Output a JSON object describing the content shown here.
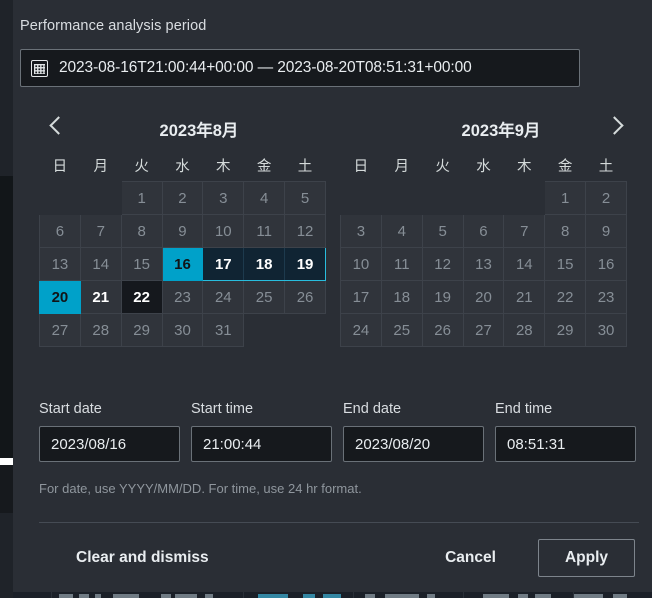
{
  "field": {
    "label": "Performance analysis period",
    "icon": "calendar-icon",
    "value": "2023-08-16T21:00:44+00:00 — 2023-08-20T08:51:31+00:00"
  },
  "calendar": {
    "prev_icon": "chevron-left-icon",
    "next_icon": "chevron-right-icon",
    "weekdays": [
      "日",
      "月",
      "火",
      "水",
      "木",
      "金",
      "土"
    ],
    "months": [
      {
        "title": "2023年8月",
        "weeks": [
          [
            {
              "day": "",
              "state": "empty"
            },
            {
              "day": "",
              "state": "empty"
            },
            {
              "day": "1",
              "state": "normal"
            },
            {
              "day": "2",
              "state": "normal"
            },
            {
              "day": "3",
              "state": "normal"
            },
            {
              "day": "4",
              "state": "normal"
            },
            {
              "day": "5",
              "state": "normal"
            }
          ],
          [
            {
              "day": "6",
              "state": "normal"
            },
            {
              "day": "7",
              "state": "normal"
            },
            {
              "day": "8",
              "state": "normal"
            },
            {
              "day": "9",
              "state": "normal"
            },
            {
              "day": "10",
              "state": "normal"
            },
            {
              "day": "11",
              "state": "normal"
            },
            {
              "day": "12",
              "state": "normal"
            }
          ],
          [
            {
              "day": "13",
              "state": "normal"
            },
            {
              "day": "14",
              "state": "normal"
            },
            {
              "day": "15",
              "state": "normal"
            },
            {
              "day": "16",
              "state": "range-start"
            },
            {
              "day": "17",
              "state": "in-range"
            },
            {
              "day": "18",
              "state": "in-range"
            },
            {
              "day": "19",
              "state": "in-range-end-row"
            }
          ],
          [
            {
              "day": "20",
              "state": "range-end"
            },
            {
              "day": "21",
              "state": "bold"
            },
            {
              "day": "22",
              "state": "today"
            },
            {
              "day": "23",
              "state": "normal"
            },
            {
              "day": "24",
              "state": "normal"
            },
            {
              "day": "25",
              "state": "normal"
            },
            {
              "day": "26",
              "state": "normal"
            }
          ],
          [
            {
              "day": "27",
              "state": "normal"
            },
            {
              "day": "28",
              "state": "normal"
            },
            {
              "day": "29",
              "state": "normal"
            },
            {
              "day": "30",
              "state": "normal"
            },
            {
              "day": "31",
              "state": "normal"
            },
            {
              "day": "",
              "state": "empty"
            },
            {
              "day": "",
              "state": "empty"
            }
          ]
        ]
      },
      {
        "title": "2023年9月",
        "weeks": [
          [
            {
              "day": "",
              "state": "empty"
            },
            {
              "day": "",
              "state": "empty"
            },
            {
              "day": "",
              "state": "empty"
            },
            {
              "day": "",
              "state": "empty"
            },
            {
              "day": "",
              "state": "empty"
            },
            {
              "day": "1",
              "state": "normal"
            },
            {
              "day": "2",
              "state": "normal"
            }
          ],
          [
            {
              "day": "3",
              "state": "normal"
            },
            {
              "day": "4",
              "state": "normal"
            },
            {
              "day": "5",
              "state": "normal"
            },
            {
              "day": "6",
              "state": "normal"
            },
            {
              "day": "7",
              "state": "normal"
            },
            {
              "day": "8",
              "state": "normal"
            },
            {
              "day": "9",
              "state": "normal"
            }
          ],
          [
            {
              "day": "10",
              "state": "normal"
            },
            {
              "day": "11",
              "state": "normal"
            },
            {
              "day": "12",
              "state": "normal"
            },
            {
              "day": "13",
              "state": "normal"
            },
            {
              "day": "14",
              "state": "normal"
            },
            {
              "day": "15",
              "state": "normal"
            },
            {
              "day": "16",
              "state": "normal"
            }
          ],
          [
            {
              "day": "17",
              "state": "normal"
            },
            {
              "day": "18",
              "state": "normal"
            },
            {
              "day": "19",
              "state": "normal"
            },
            {
              "day": "20",
              "state": "normal"
            },
            {
              "day": "21",
              "state": "normal"
            },
            {
              "day": "22",
              "state": "normal"
            },
            {
              "day": "23",
              "state": "normal"
            }
          ],
          [
            {
              "day": "24",
              "state": "normal"
            },
            {
              "day": "25",
              "state": "normal"
            },
            {
              "day": "26",
              "state": "normal"
            },
            {
              "day": "27",
              "state": "normal"
            },
            {
              "day": "28",
              "state": "normal"
            },
            {
              "day": "29",
              "state": "normal"
            },
            {
              "day": "30",
              "state": "normal"
            }
          ]
        ]
      }
    ]
  },
  "inputs": [
    {
      "label": "Start date",
      "value": "2023/08/16",
      "name": "start-date-input"
    },
    {
      "label": "Start time",
      "value": "21:00:44",
      "name": "start-time-input"
    },
    {
      "label": "End date",
      "value": "2023/08/20",
      "name": "end-date-input"
    },
    {
      "label": "End time",
      "value": "08:51:31",
      "name": "end-time-input"
    }
  ],
  "hint": "For date, use YYYY/MM/DD. For time, use 24 hr format.",
  "footer": {
    "clear": "Clear and dismiss",
    "cancel": "Cancel",
    "apply": "Apply"
  },
  "colors": {
    "accent": "#00a1c9",
    "range_border": "#28bddd",
    "range_fill": "#102433",
    "panel": "#2a2e35",
    "cell": "#30343b"
  }
}
